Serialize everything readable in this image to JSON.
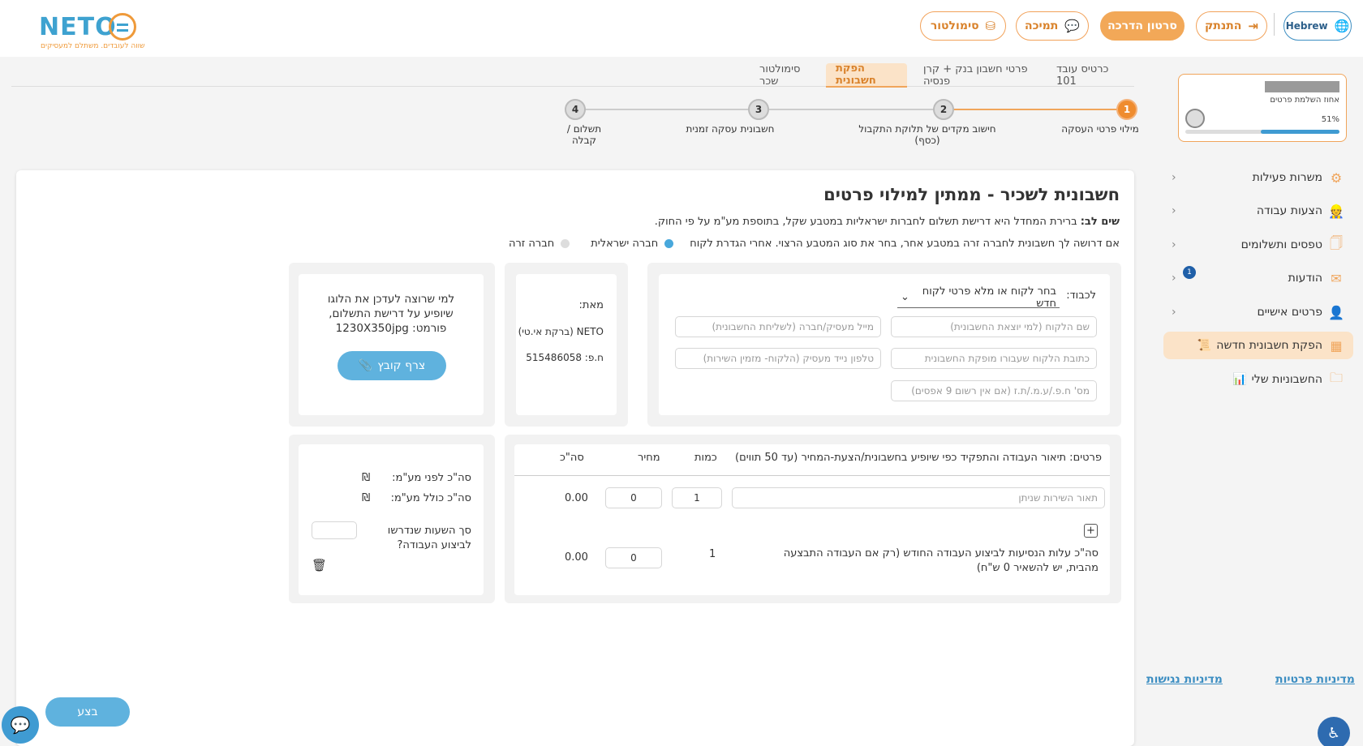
{
  "brand": {
    "logo": "NETO",
    "tagline": "שווה לעובדים. משתלם למעסיקים"
  },
  "header": {
    "lang_label": "Hebrew",
    "logout_label": "התנתק",
    "tutorial_label": "סרטון הדרכה",
    "support_label": "תמיכה",
    "simulator_label": "סימולטור",
    "accent": "#f2a858"
  },
  "profile": {
    "progress_label": "אחוז השלמת פרטים",
    "percent_text": "51%",
    "percent": 51
  },
  "sidebar": {
    "items": [
      {
        "label": "משרות פעילות",
        "icon": "gear-icon"
      },
      {
        "label": "הצעות עבודה",
        "icon": "worker-icon"
      },
      {
        "label": "טפסים ותשלומים",
        "icon": "documents-icon"
      },
      {
        "label": "הודעות",
        "icon": "envelope-icon",
        "badge": "1"
      },
      {
        "label": "פרטים אישיים",
        "icon": "user-icon"
      },
      {
        "label": "הפקת חשבונית חדשה",
        "icon": "invoice-icon"
      },
      {
        "label": "החשבוניות שלי",
        "icon": "folder-icon"
      }
    ],
    "privacy_link": "מדיניות פרטיות",
    "accessibility_link": "מדיניות נגישות"
  },
  "tabs": [
    {
      "label": "כרטיס עובד 101"
    },
    {
      "label": "פרטי חשבון בנק + קרן פנסיה"
    },
    {
      "label": "הפקת חשבונית"
    },
    {
      "label": "סימולטור שכר"
    }
  ],
  "stepper": [
    {
      "num": "1",
      "label": "מילוי פרטי העסקה"
    },
    {
      "num": "2",
      "label": "חישוב מקדים של תלוקת התקבול (כסף)"
    },
    {
      "num": "3",
      "label": "חשבונית עסקה זמנית"
    },
    {
      "num": "4",
      "label": "תשלום / קבלה"
    }
  ],
  "form": {
    "title": "חשבונית לשכיר - ממתין למילוי פרטים",
    "note_bold": "שים לב:",
    "note_text": " ברירת המחדל היא דרישת תשלום לחברות ישראליות במטבע שקל, בתוספת מע\"מ על פי החוק.",
    "foreign_text": "אם דרושה לך חשבונית לחברה זרה במטבע אחר, בחר את סוג המטבע הרצוי. אחרי הגדרת לקוח",
    "radio_israeli": "חברה ישראלית",
    "radio_foreign": "חברה זרה",
    "to_label": "לכבוד:",
    "client_select": "בחר לקוח או מלא פרטי לקוח חדש",
    "client_name_ph": "שם הלקוח (למי יוצאת החשבונית)",
    "employer_email_ph": "מייל מעסיק/חברה (לשליחת החשבונית)",
    "client_address_ph": "כתובת הלקוח שעבורו מופקת החשבונית",
    "employer_phone_ph": "טלפון נייד מעסיק (הלקוח- מזמין השירות)",
    "client_id_ph": "מס' ח.פ./ע.מ./ת.ז (אם אין רשום 9 אפסים)",
    "from_label": "מאת:",
    "from_name": "NETO (ברקת אי.טי)",
    "from_company_id": "ח.פ: 515486058",
    "logo_hint": "למי שרוצה לעדכן את הלוגו שיופיע על דרישת התשלום, פורמט: 1230X350jpg",
    "attach_label": "צרף קובץ",
    "details_header": "פרטים: תיאור העבודה והתפקיד כפי שיופיע בחשבונית/הצעת-המחיר (עד 50 תווים)",
    "qty_header": "כמות",
    "price_header": "מחיר",
    "total_header": "סה\"כ",
    "service_ph": "תאור השירות שניתן",
    "qty_value": "1",
    "price_value": "0",
    "line_total": "0.00",
    "travel_label": "סה\"כ עלות הנסיעות לביצוע העבודה החודש (רק אם העבודה התבצעה מהבית, יש להשאיר 0 ש\"ח)",
    "travel_qty": "1",
    "travel_price": "0",
    "travel_total": "0.00",
    "sum_before_vat": "סה\"כ לפני מע\"מ:",
    "sum_with_vat": "סה\"כ כולל מע\"מ:",
    "currency": "₪",
    "hours_question": "סך השעות שנדרשו לביצוע העבודה?",
    "submit_label": "בצע"
  }
}
